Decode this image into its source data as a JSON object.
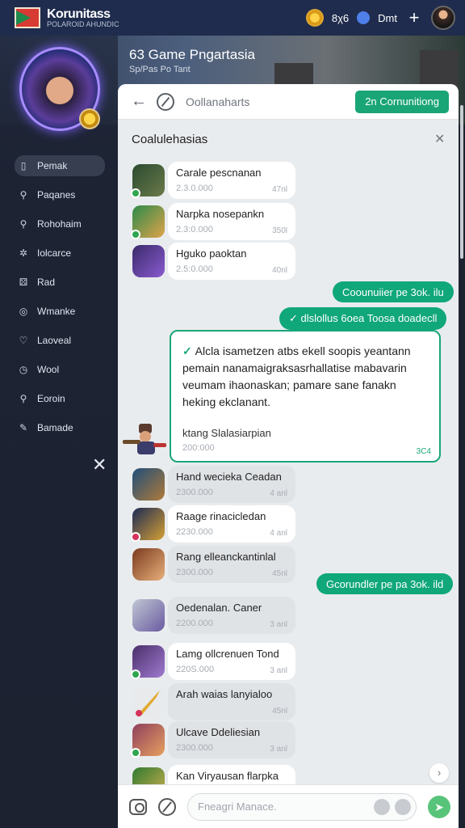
{
  "topbar": {
    "brand_title": "Korunitass",
    "brand_sub": "POLAROID AHUNDIC",
    "count": "8χ6",
    "user": "Dmt"
  },
  "banner": {
    "title": "63 Game Pngartasia",
    "subtitle": "Sp/Pas Po Tant"
  },
  "sidebar": {
    "items": [
      {
        "label": "Pemak",
        "icon": "doc-icon"
      },
      {
        "label": "Paqanes",
        "icon": "search-icon"
      },
      {
        "label": "Rohohaim",
        "icon": "search-icon"
      },
      {
        "label": "Iolcarce",
        "icon": "gear-icon"
      },
      {
        "label": "Rad",
        "icon": "dice-icon"
      },
      {
        "label": "Wmanke",
        "icon": "globe-icon"
      },
      {
        "label": "Laoveal",
        "icon": "heart-icon"
      },
      {
        "label": "Wool",
        "icon": "clock-icon"
      },
      {
        "label": "Eoroin",
        "icon": "search-icon"
      },
      {
        "label": "Bamade",
        "icon": "edit-icon"
      }
    ]
  },
  "chat": {
    "header_name": "Oollanaharts",
    "header_button": "2n Cornunitiong",
    "title": "Coalulehasias",
    "input_placeholder": "Fneagri Manace.",
    "messages": [
      {
        "name": "Carale pescnanan",
        "meta": "2.3.0.000",
        "time": "47nl",
        "color": "#3b5a3e"
      },
      {
        "name": "Narpka nosepankn",
        "meta": "2.3:0.000",
        "time": "350l",
        "color": "#2b8a4a"
      },
      {
        "name": "Hguko paoktan",
        "meta": "2.5:0.000",
        "time": "40nl",
        "color": "#5b3d9a"
      },
      {
        "name": "Hand wecieka Ceadan",
        "meta": "2300.000",
        "time": "4 anl",
        "color": "#2d6e9c"
      },
      {
        "name": "Raage rinacicledan",
        "meta": "2230.000",
        "time": "4 anl",
        "color": "#203463"
      },
      {
        "name": "Rang elleanckantinlal",
        "meta": "2300.000",
        "time": "45nl",
        "color": "#8a4a2a"
      },
      {
        "name": "Oedenalan. Caner",
        "meta": "2200.000",
        "time": "3 anl",
        "color": "#9aa6b8"
      },
      {
        "name": "Lamg ollcrenuen Tond",
        "meta": "220S.000",
        "time": "3 anl",
        "color": "#6a4d8f"
      },
      {
        "name": "Arah waias lanyialoo",
        "meta": "",
        "time": "45nl",
        "color": "#e7b133"
      },
      {
        "name": "Ulcave Ddeliesian",
        "meta": "2300.000",
        "time": "3 anl",
        "color": "#8f3f5c"
      },
      {
        "name": "Kan Viryausan flarpka",
        "meta": "",
        "time": "",
        "color": "#3f8a3a"
      }
    ],
    "pill_1": "Coounuiier pe 3ok. ilu",
    "pill_2": "✓ dlslollus 6oea Toosa doadecll",
    "pill_3": "Gcorundler pe pa 3ok. ild",
    "card": {
      "body": "Alcla isametzen atbs ekell soopis yeantann pemain nanamaigraksasrhallatise mabavarin veumam ihaonaskan; pamare sane fanakn heking ekclanant.",
      "sig": "ktang Slalasiarpian",
      "date": "200:000",
      "time": "3C4"
    }
  }
}
